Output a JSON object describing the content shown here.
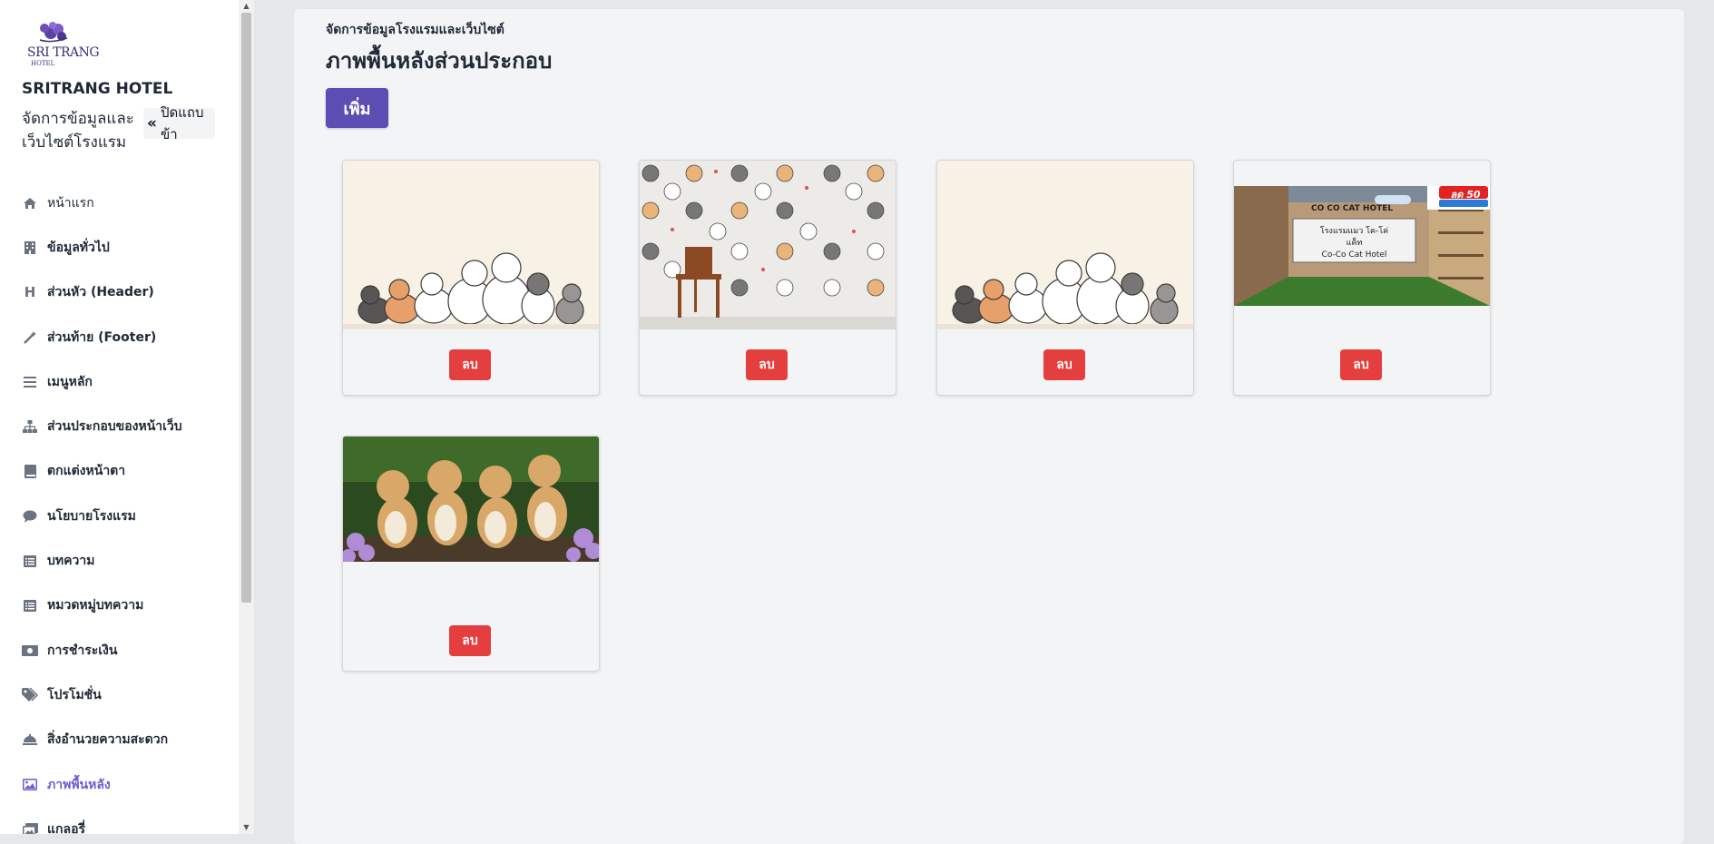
{
  "brand": {
    "logo_text": "SRI TRANG",
    "logo_sub": "HOTEL",
    "hotel_name": "SRITRANG HOTEL",
    "subtitle": "จัดการข้อมูลและเว็บไซต์โรงแรม",
    "collapse_label": "ปิดแถบข้า",
    "accent": "#5b4db3"
  },
  "nav": {
    "items": [
      {
        "label": "หน้าแรก",
        "icon": "home-icon"
      },
      {
        "label": "ข้อมูลทั่วไป",
        "icon": "building-icon"
      },
      {
        "label": "ส่วนหัว (Header)",
        "icon": "heading-icon"
      },
      {
        "label": "ส่วนท้าย (Footer)",
        "icon": "magic-wand-icon"
      },
      {
        "label": "เมนูหลัก",
        "icon": "bars-icon"
      },
      {
        "label": "ส่วนประกอบของหน้าเว็บ",
        "icon": "sitemap-icon"
      },
      {
        "label": "ตกแต่งหน้าตา",
        "icon": "book-icon"
      },
      {
        "label": "นโยบายโรงแรม",
        "icon": "comment-icon"
      },
      {
        "label": "บทความ",
        "icon": "list-icon"
      },
      {
        "label": "หมวดหมู่บทความ",
        "icon": "list-icon"
      },
      {
        "label": "การชำระเงิน",
        "icon": "money-icon"
      },
      {
        "label": "โปรโมชั่น",
        "icon": "tags-icon"
      },
      {
        "label": "สิ่งอำนวยความสะดวก",
        "icon": "service-bell-icon"
      },
      {
        "label": "ภาพพื้นหลัง",
        "icon": "image-icon"
      },
      {
        "label": "แกลอรี่",
        "icon": "images-icon"
      }
    ],
    "active_index": 13
  },
  "main": {
    "breadcrumb": "จัดการข้อมูลโรงแรมและเว็บไซต์",
    "title": "ภาพพื้นหลังส่วนประกอบ",
    "add_label": "เพิ่ม",
    "delete_label": "ลบ",
    "signboard_line1": "โรงแรมแมว โค-โค่ แค็ท",
    "signboard_line2": "Co-Co Cat Hotel",
    "banner_line": "CO CO CAT HOTEL",
    "banner_badge": "ลด 50"
  },
  "images": [
    {
      "subject": "cartoon cats on cream background"
    },
    {
      "subject": "cartoon cat wallpaper with wooden chair"
    },
    {
      "subject": "cartoon cats on cream background"
    },
    {
      "subject": "Co-Co Cat Hotel lobby photo"
    },
    {
      "subject": "four kittens with purple flowers"
    }
  ]
}
